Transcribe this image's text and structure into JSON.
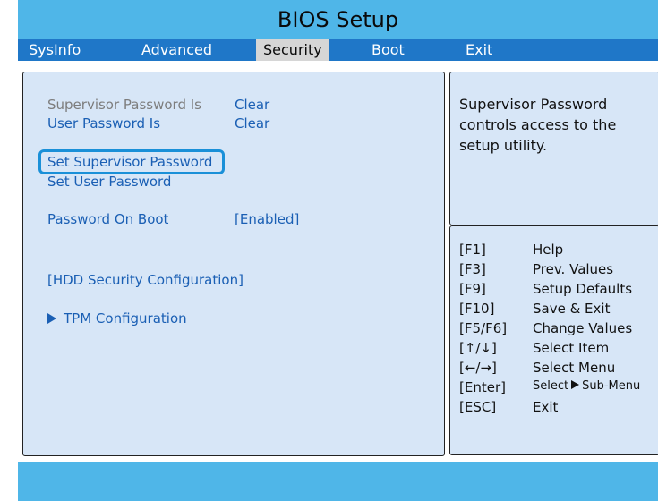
{
  "title": "BIOS Setup",
  "menu": {
    "tabs": [
      {
        "label": "SysInfo"
      },
      {
        "label": "Advanced"
      },
      {
        "label": "Security",
        "active": true
      },
      {
        "label": "Boot"
      },
      {
        "label": "Exit"
      }
    ]
  },
  "security": {
    "supervisor_password_label": "Supervisor Password Is",
    "supervisor_password_value": "Clear",
    "user_password_label": "User Password Is",
    "user_password_value": "Clear",
    "set_supervisor_password": "Set Supervisor Password",
    "set_user_password": "Set User Password",
    "password_on_boot_label": "Password On Boot",
    "password_on_boot_value": "[Enabled]",
    "hdd_security": "[HDD Security Configuration]",
    "tpm_configuration": "TPM Configuration"
  },
  "help": {
    "text": "Supervisor Password controls access to the setup utility."
  },
  "keys": [
    {
      "key": "[F1]",
      "desc": "Help"
    },
    {
      "key": "[F3]",
      "desc": "Prev. Values"
    },
    {
      "key": "[F9]",
      "desc": "Setup Defaults"
    },
    {
      "key": "[F10]",
      "desc": "Save & Exit"
    },
    {
      "key": "[F5/F6]",
      "desc": "Change Values"
    },
    {
      "key": "[↑/↓]",
      "desc": "Select Item"
    },
    {
      "key": "[←/→]",
      "desc": "Select Menu"
    },
    {
      "key": "[Enter]",
      "desc_prefix": "Select",
      "desc_suffix": "Sub-Menu"
    },
    {
      "key": "[ESC]",
      "desc": "Exit"
    }
  ],
  "colors": {
    "title_bar": "#4fb6e8",
    "menu_bar": "#1f77c8",
    "panel": "#d7e6f7",
    "focus": "#1a90d8",
    "item_text": "#1a5fb4"
  }
}
